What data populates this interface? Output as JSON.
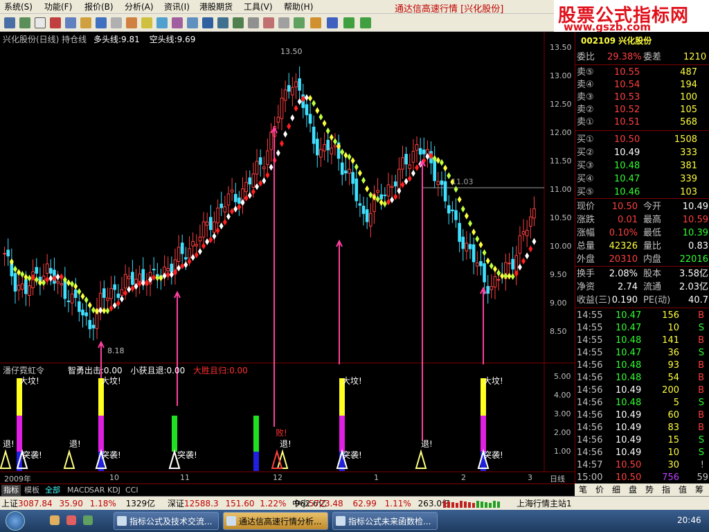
{
  "menu": {
    "items": [
      "系统(S)",
      "功能(F)",
      "报价(B)",
      "分析(A)",
      "资讯(I)",
      "港股期货",
      "工具(V)",
      "帮助(H)"
    ],
    "title": "通达信高速行情 [兴化股份]"
  },
  "logo": {
    "line1": "股票公式指标网",
    "line2": "www.gszb.com"
  },
  "chart": {
    "header": "兴化股份(日线) 持仓线",
    "long_label": "多头线:9.81",
    "short_label": "空头线:9.69",
    "high_label": "13.50",
    "low_label": "8.18",
    "ref_label": "11.03",
    "price_axis": [
      "13.50",
      "13.00",
      "12.50",
      "12.00",
      "11.50",
      "11.00",
      "10.50",
      "10.00",
      "9.50",
      "9.00",
      "8.50"
    ],
    "indicator_header": "潘仔霓虹令",
    "ind_items": [
      {
        "text": "智勇出击:0.00",
        "color": "#FFFFFF"
      },
      {
        "text": "小获且退:0.00",
        "color": "#FFFFFF"
      },
      {
        "text": "大胜且归:0.00",
        "color": "#FF3030"
      }
    ],
    "ind_axis": [
      "5.00",
      "4.00",
      "3.00",
      "2.00",
      "1.00"
    ],
    "signal_texts": {
      "big_buy": "大坟!",
      "attack": "突袭!",
      "retreat": "退!",
      "defeat": "败!"
    },
    "date_axis": [
      "2009年",
      "10",
      "11",
      "12",
      "1",
      "2",
      "3"
    ],
    "period_label": "日线"
  },
  "quote_panel": {
    "code_name": "002109 兴化股份",
    "weibi": {
      "label": "委比",
      "value": "29.38%",
      "label2": "委差",
      "value2": "1210"
    },
    "asks": [
      {
        "label": "卖⑤",
        "price": "10.55",
        "vol": "487"
      },
      {
        "label": "卖④",
        "price": "10.54",
        "vol": "194"
      },
      {
        "label": "卖③",
        "price": "10.53",
        "vol": "100"
      },
      {
        "label": "卖②",
        "price": "10.52",
        "vol": "105"
      },
      {
        "label": "卖①",
        "price": "10.51",
        "vol": "568"
      }
    ],
    "bids": [
      {
        "label": "买①",
        "price": "10.50",
        "vol": "1508"
      },
      {
        "label": "买②",
        "price": "10.49",
        "vol": "333"
      },
      {
        "label": "买③",
        "price": "10.48",
        "vol": "381"
      },
      {
        "label": "买④",
        "price": "10.47",
        "vol": "339"
      },
      {
        "label": "买⑤",
        "price": "10.46",
        "vol": "103"
      }
    ],
    "stats": [
      {
        "l1": "现价",
        "v1": "10.50",
        "c1": "#FF4040",
        "l2": "今开",
        "v2": "10.49",
        "c2": "#FFFFFF"
      },
      {
        "l1": "涨跌",
        "v1": "0.01",
        "c1": "#FF4040",
        "l2": "最高",
        "v2": "10.59",
        "c2": "#FF4040"
      },
      {
        "l1": "涨幅",
        "v1": "0.10%",
        "c1": "#FF4040",
        "l2": "最低",
        "v2": "10.39",
        "c2": "#30FF30"
      },
      {
        "l1": "总量",
        "v1": "42326",
        "c1": "#FFFF40",
        "l2": "量比",
        "v2": "0.83",
        "c2": "#FFFFFF"
      },
      {
        "l1": "外盘",
        "v1": "20310",
        "c1": "#FF4040",
        "l2": "内盘",
        "v2": "22016",
        "c2": "#30FF30"
      }
    ],
    "stats2": [
      {
        "l1": "换手",
        "v1": "2.08%",
        "l2": "股本",
        "v2": "3.58亿"
      },
      {
        "l1": "净资",
        "v1": "2.74",
        "l2": "流通",
        "v2": "2.03亿"
      },
      {
        "l1": "收益(三)",
        "v1": "0.190",
        "l2": "PE(动)",
        "v2": "40.7"
      }
    ],
    "ticks": [
      {
        "t": "14:55",
        "p": "10.47",
        "pc": "#30FF30",
        "v": "156",
        "d": "B"
      },
      {
        "t": "14:55",
        "p": "10.47",
        "pc": "#30FF30",
        "v": "10",
        "d": "S"
      },
      {
        "t": "14:55",
        "p": "10.48",
        "pc": "#30FF30",
        "v": "141",
        "d": "B"
      },
      {
        "t": "14:55",
        "p": "10.47",
        "pc": "#30FF30",
        "v": "36",
        "d": "S"
      },
      {
        "t": "14:56",
        "p": "10.48",
        "pc": "#30FF30",
        "v": "93",
        "d": "B"
      },
      {
        "t": "14:56",
        "p": "10.48",
        "pc": "#30FF30",
        "v": "54",
        "d": "B"
      },
      {
        "t": "14:56",
        "p": "10.49",
        "pc": "#FFFFFF",
        "v": "200",
        "d": "B"
      },
      {
        "t": "14:56",
        "p": "10.48",
        "pc": "#30FF30",
        "v": "5",
        "d": "S"
      },
      {
        "t": "14:56",
        "p": "10.49",
        "pc": "#FFFFFF",
        "v": "60",
        "d": "B"
      },
      {
        "t": "14:56",
        "p": "10.49",
        "pc": "#FFFFFF",
        "v": "83",
        "d": "B"
      },
      {
        "t": "14:56",
        "p": "10.49",
        "pc": "#FFFFFF",
        "v": "15",
        "d": "S"
      },
      {
        "t": "14:56",
        "p": "10.49",
        "pc": "#FFFFFF",
        "v": "10",
        "d": "S"
      },
      {
        "t": "14:57",
        "p": "10.50",
        "pc": "#FF4040",
        "v": "30",
        "d": "!"
      },
      {
        "t": "15:00",
        "p": "10.50",
        "pc": "#FF4040",
        "v": "756",
        "d": "59"
      }
    ]
  },
  "bottom_tabs": [
    "指标",
    "模板",
    "全部",
    "MACD",
    "SAR",
    "KDJ",
    "CCI"
  ],
  "rp_tabs": [
    "笔",
    "价",
    "细",
    "盘",
    "势",
    "指",
    "值",
    "筹"
  ],
  "status": {
    "sh_label": "上证",
    "sh_val": "3087.84",
    "sh_chg": "35.90",
    "sh_pct": "1.18%",
    "sh_amt": "1329亿",
    "sz_label": "深证",
    "sz_val": "12588.3",
    "sz_chg": "151.60",
    "sz_pct": "1.22%",
    "sz_amt": "962.6亿",
    "zx_label": "中小",
    "zx_val": "5723.48",
    "zx_chg": "62.99",
    "zx_pct": "1.11%",
    "zx_amt": "263.0亿",
    "server": "上海行情主站1"
  },
  "taskbar": {
    "tasks": [
      "指标公式及技术交流...",
      "通达信高速行情分析...",
      "指标公式未来函数检..."
    ],
    "time": "20:46"
  }
}
